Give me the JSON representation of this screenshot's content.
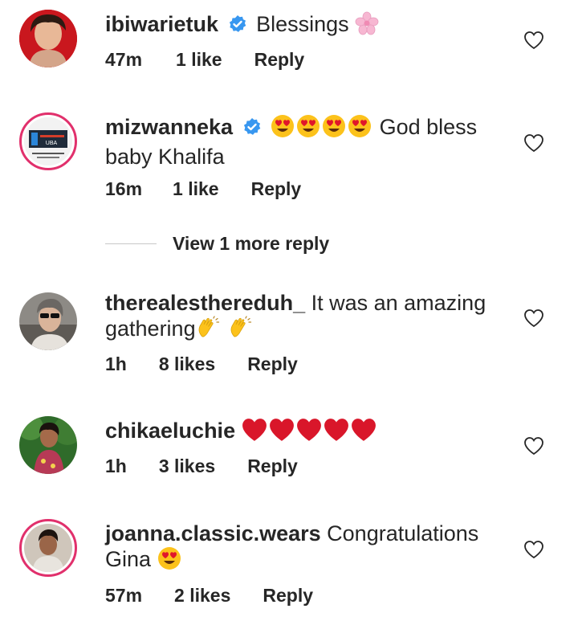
{
  "comments": [
    {
      "username": "ibiwarietuk",
      "verified": true,
      "text": "Blessings",
      "emoji_icons": [
        "cherry-blossom-icon"
      ],
      "time": "47m",
      "likes": "1 like",
      "reply": "Reply"
    },
    {
      "username": "mizwanneka",
      "verified": true,
      "emoji_icons": [
        "heart-eyes-icon",
        "heart-eyes-icon",
        "heart-eyes-icon",
        "heart-eyes-icon"
      ],
      "text": "God bless",
      "text_line2": "baby  Khalifa",
      "avatar_text": "UBA",
      "time": "16m",
      "likes": "1 like",
      "reply": "Reply"
    },
    {
      "username": "therealesthereduh_",
      "verified": false,
      "text": "It was an amazing",
      "text_line2": "gathering",
      "emoji_icons": [
        "clapping-hands-icon",
        "clapping-hands-icon"
      ],
      "time": "1h",
      "likes": "8 likes",
      "reply": "Reply"
    },
    {
      "username": "chikaeluchie",
      "verified": false,
      "emoji_icons": [
        "red-heart-icon",
        "red-heart-icon",
        "red-heart-icon",
        "red-heart-icon",
        "red-heart-icon"
      ],
      "time": "1h",
      "likes": "3 likes",
      "reply": "Reply"
    },
    {
      "username": "joanna.classic.wears",
      "verified": false,
      "text": "Congratulations",
      "text_line2": "Gina",
      "emoji_icons": [
        "heart-eyes-icon"
      ],
      "time": "57m",
      "likes": "2 likes",
      "reply": "Reply"
    }
  ],
  "view_more_replies": "View 1 more reply",
  "colors": {
    "verified_blue": "#3897f0",
    "story_ring": "#e1306c",
    "text": "#262626",
    "heart_red": "#e0162b"
  }
}
